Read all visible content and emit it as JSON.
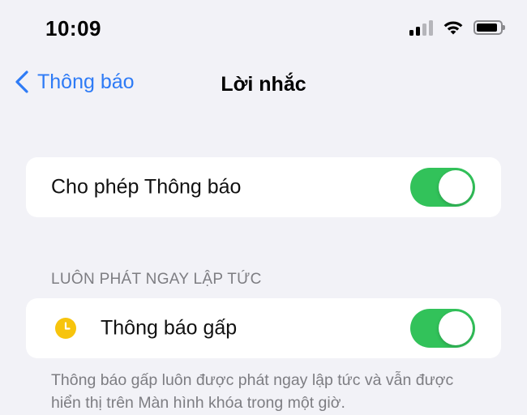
{
  "status_bar": {
    "time": "10:09",
    "icons": [
      "cellular-signal-icon",
      "wifi-icon",
      "battery-icon"
    ]
  },
  "nav": {
    "back_label": "Thông báo",
    "title": "Lời nhắc"
  },
  "allow_notifications": {
    "label": "Cho phép Thông báo",
    "enabled": true
  },
  "section": {
    "header": "LUÔN PHÁT NGAY LẬP TỨC",
    "urgent": {
      "label": "Thông báo gấp",
      "icon": "clock-icon",
      "enabled": true
    },
    "footer": "Thông báo gấp luôn được phát ngay lập tức và vẫn được hiển thị trên Màn hình khóa trong một giờ."
  },
  "colors": {
    "accent": "#2e7bf6",
    "toggle_on": "#32c25a",
    "clock": "#f7c40d",
    "background": "#f2f2f7"
  }
}
